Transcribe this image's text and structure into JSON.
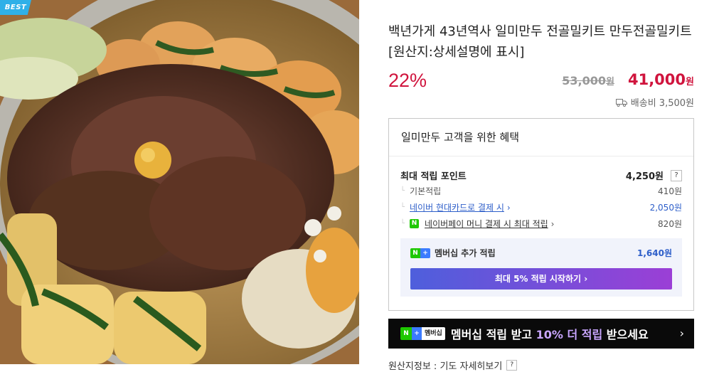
{
  "product": {
    "badge": "BEST",
    "image_alt": "전골 사진",
    "title": "백년가게 43년역사 일미만두 전골밀키트 만두전골밀키트 [원산지:상세설명에 표시]",
    "discount": "22%",
    "original_price": "53,000",
    "original_price_unit": "원",
    "sale_price": "41,000",
    "sale_price_unit": "원",
    "shipping": "배송비 3,500원"
  },
  "benefits": {
    "title": "일미만두 고객을 위한 혜택",
    "max_points_label": "최대 적립 포인트",
    "max_points_value": "4,250원",
    "help_label": "?",
    "basic_label": "기본적립",
    "basic_value": "410원",
    "card_label": "네이버 현대카드로 결제 시",
    "card_value": "2,050원",
    "npay_label": "네이버페이 머니 결제 시 최대 적립",
    "npay_value": "820원",
    "member_label": "멤버십 추가 적립",
    "member_value": "1,640원",
    "member_cta": "최대 5% 적립 시작하기"
  },
  "banner": {
    "badge_text": "멤버십",
    "text_part1": "멤버십 적립 받고 ",
    "text_highlight": "10% 더 적립",
    "text_part2": " 받으세요"
  },
  "origin": {
    "label": "원산지정보 : 기도 자세히보기"
  },
  "colors": {
    "accent_red": "#d0143d",
    "link_blue": "#2d5ec9",
    "naver_green": "#1ec800"
  }
}
